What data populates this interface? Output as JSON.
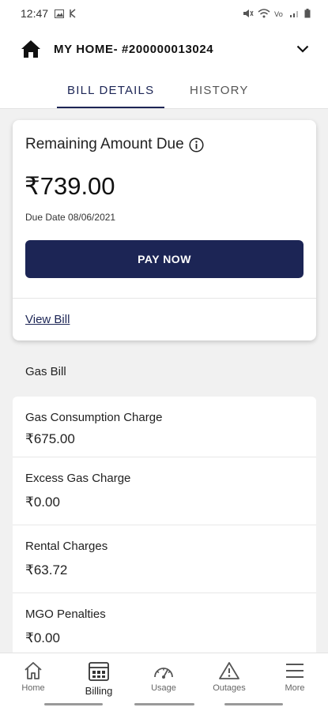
{
  "status_bar": {
    "time": "12:47"
  },
  "header": {
    "account_title": "MY HOME- #200000013024"
  },
  "tabs": [
    {
      "label": "BILL DETAILS",
      "active": true
    },
    {
      "label": "HISTORY",
      "active": false
    }
  ],
  "bill_card": {
    "title": "Remaining Amount Due",
    "amount": "₹739.00",
    "due_date": "Due Date 08/06/2021",
    "pay_button": "PAY NOW",
    "view_bill_link": "View Bill"
  },
  "section": {
    "title": "Gas Bill"
  },
  "charges": [
    {
      "label": "Gas Consumption Charge",
      "value": "₹675.00"
    },
    {
      "label": "Excess Gas Charge",
      "value": "₹0.00"
    },
    {
      "label": "Rental Charges",
      "value": "₹63.72"
    },
    {
      "label": "MGO Penalties",
      "value": "₹0.00"
    }
  ],
  "nav": [
    {
      "label": "Home",
      "icon": "home-icon",
      "active": false
    },
    {
      "label": "Billing",
      "icon": "billing-icon",
      "active": true
    },
    {
      "label": "Usage",
      "icon": "usage-icon",
      "active": false
    },
    {
      "label": "Outages",
      "icon": "outages-icon",
      "active": false
    },
    {
      "label": "More",
      "icon": "menu-icon",
      "active": false
    }
  ],
  "colors": {
    "primary": "#1c2555",
    "background": "#f1f1f1"
  }
}
